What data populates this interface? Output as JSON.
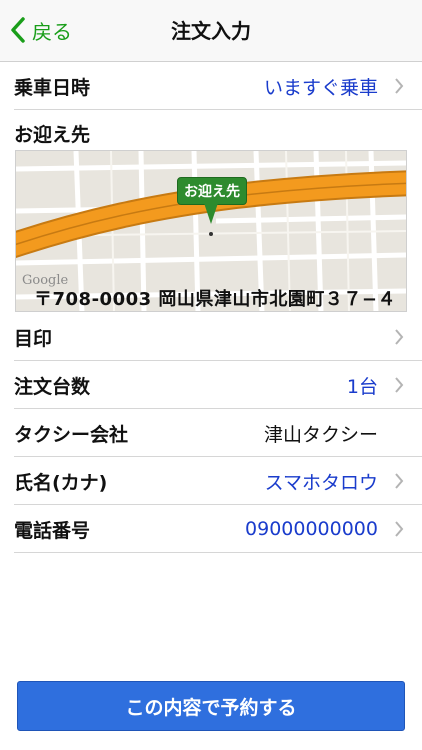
{
  "navbar": {
    "back_label": "戻る",
    "title": "注文入力"
  },
  "rows": {
    "ride_time": {
      "label": "乗車日時",
      "value": "いますぐ乗車"
    },
    "pickup_label": "お迎え先",
    "landmark": {
      "label": "目印"
    },
    "taxi_count": {
      "label": "注文台数",
      "value": "1台"
    },
    "taxi_company": {
      "label": "タクシー会社",
      "value": "津山タクシー"
    },
    "name_kana": {
      "label": "氏名(カナ)",
      "value": "スマホタロウ"
    },
    "phone": {
      "label": "電話番号",
      "value": "09000000000"
    }
  },
  "map": {
    "pin_label": "お迎え先",
    "address": "〒708-0003 岡山県津山市北園町３７−４",
    "attribution": "Google",
    "road_color": "#f39a1e"
  },
  "submit_button": {
    "label": "この内容で予約する"
  },
  "colors": {
    "accent_green": "#1a9e1a",
    "link_blue": "#1a3ccc",
    "button_blue": "#2f6fde"
  }
}
